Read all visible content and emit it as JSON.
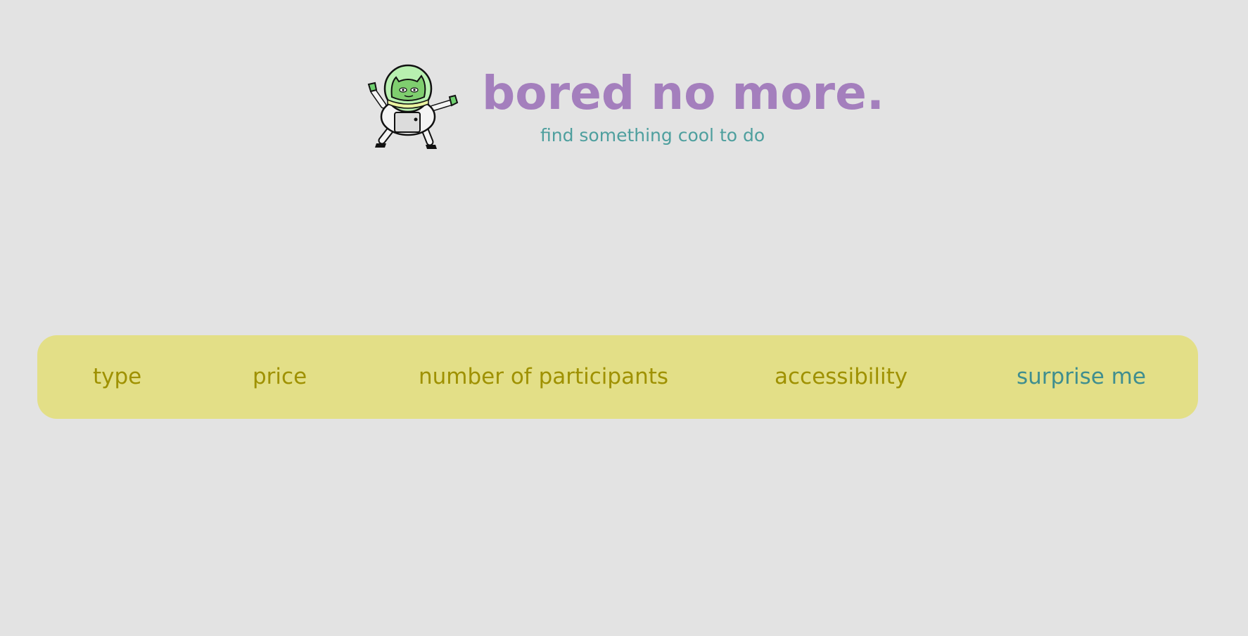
{
  "header": {
    "title": "bored no more.",
    "subtitle": "find something cool to do",
    "mascot_icon": "astronaut-cat-icon"
  },
  "nav": {
    "items": [
      {
        "label": "type"
      },
      {
        "label": "price"
      },
      {
        "label": "number of participants"
      },
      {
        "label": "accessibility"
      },
      {
        "label": "surprise me"
      }
    ]
  },
  "colors": {
    "background": "#e3e3e3",
    "title": "#a47fbd",
    "subtitle": "#4e9f9e",
    "nav_background": "#e3df87",
    "nav_text": "#9f9100",
    "nav_accent": "#3f8e8f"
  }
}
